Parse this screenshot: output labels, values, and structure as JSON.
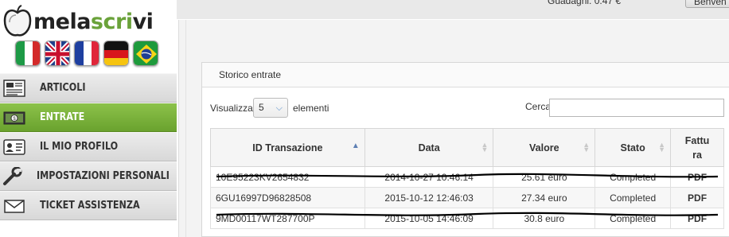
{
  "brand": {
    "w1": "mela",
    "w2": "scri",
    "w3": "vi"
  },
  "flags": [
    "italy-flag",
    "uk-flag",
    "france-flag",
    "germany-flag",
    "brazil-flag"
  ],
  "topbar": {
    "guadagni_label": "Guadagni:",
    "guadagni_value": "0.47 €",
    "benvenuto": "Benven"
  },
  "menu": [
    {
      "label": "ARTICOLI",
      "icon": "articles-icon",
      "active": false
    },
    {
      "label": "ENTRATE",
      "icon": "money-icon",
      "active": true
    },
    {
      "label": "IL MIO PROFILO",
      "icon": "id-card-icon",
      "active": false
    },
    {
      "label": "IMPOSTAZIONI PERSONALI",
      "icon": "wrench-icon",
      "active": false
    },
    {
      "label": "TICKET ASSISTENZA",
      "icon": "envelope-icon",
      "active": false
    }
  ],
  "panel": {
    "title": "Storico entrate",
    "visualizza": "Visualizza",
    "page_size": "5",
    "elementi": "elementi",
    "cerca": "Cerca",
    "columns": [
      "ID Transazione",
      "Data",
      "Valore",
      "Stato",
      "Fattura"
    ],
    "rows": [
      {
        "id": "10E95223KV2654832",
        "date": "2014-10-27 10:46:14",
        "value": "25.61 euro",
        "status": "Completed",
        "invoice": "PDF",
        "struck": true
      },
      {
        "id": "6GU16997D96828508",
        "date": "2015-10-12 12:46:03",
        "value": "27.34 euro",
        "status": "Completed",
        "invoice": "PDF",
        "struck": false
      },
      {
        "id": "9MD00117WT287700P",
        "date": "2015-10-05 14:46:09",
        "value": "30.8 euro",
        "status": "Completed",
        "invoice": "PDF",
        "struck": true
      }
    ]
  }
}
